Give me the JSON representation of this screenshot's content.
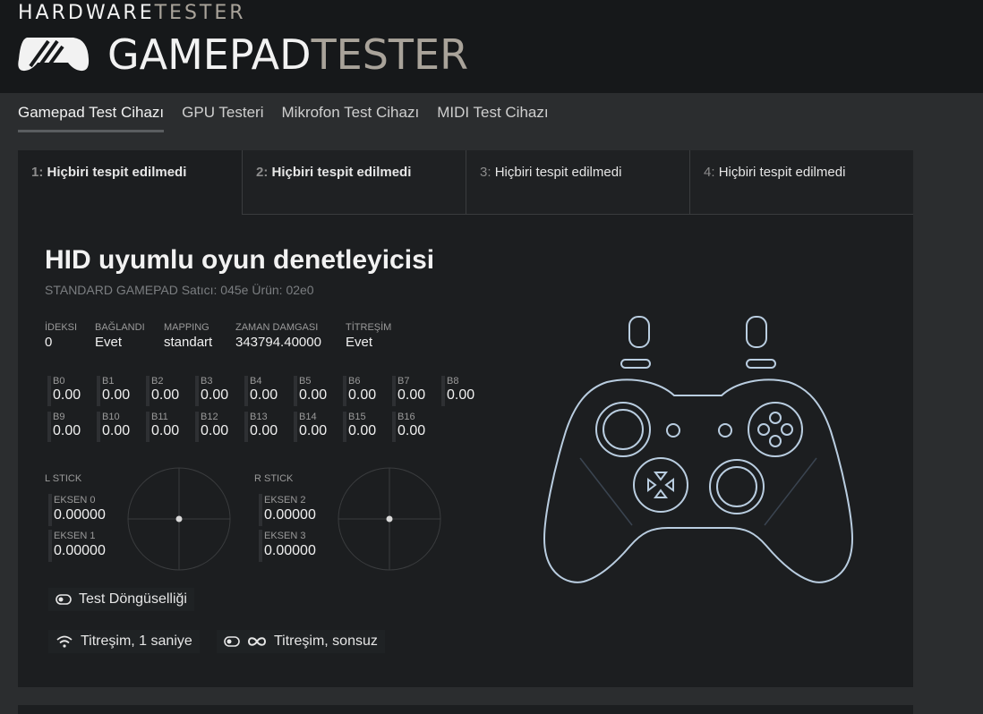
{
  "brand": {
    "small_1": "HARDWARE",
    "small_2": "TESTER",
    "big_1": "GAMEPAD",
    "big_2": "TESTER"
  },
  "nav": [
    "Gamepad Test Cihazı",
    "GPU Testeri",
    "Mikrofon Test Cihazı",
    "MIDI Test Cihazı"
  ],
  "tabs": [
    {
      "num": "1:",
      "label": "Hiçbiri tespit edilmedi"
    },
    {
      "num": "2:",
      "label": "Hiçbiri tespit edilmedi"
    },
    {
      "num": "3:",
      "label": "Hiçbiri tespit edilmedi"
    },
    {
      "num": "4:",
      "label": "Hiçbiri tespit edilmedi"
    }
  ],
  "device": {
    "title": "HID uyumlu oyun denetleyicisi",
    "subtitle": "STANDARD GAMEPAD Satıcı: 045e Ürün: 02e0"
  },
  "info": [
    {
      "label": "İDEKSI",
      "value": "0"
    },
    {
      "label": "BAĞLANDI",
      "value": "Evet"
    },
    {
      "label": "MAPPING",
      "value": "standart"
    },
    {
      "label": "ZAMAN DAMGASI",
      "value": "343794.40000"
    },
    {
      "label": "TİTREŞİM",
      "value": "Evet"
    }
  ],
  "buttons": [
    {
      "label": "B0",
      "value": "0.00"
    },
    {
      "label": "B1",
      "value": "0.00"
    },
    {
      "label": "B2",
      "value": "0.00"
    },
    {
      "label": "B3",
      "value": "0.00"
    },
    {
      "label": "B4",
      "value": "0.00"
    },
    {
      "label": "B5",
      "value": "0.00"
    },
    {
      "label": "B6",
      "value": "0.00"
    },
    {
      "label": "B7",
      "value": "0.00"
    },
    {
      "label": "B8",
      "value": "0.00"
    },
    {
      "label": "B9",
      "value": "0.00"
    },
    {
      "label": "B10",
      "value": "0.00"
    },
    {
      "label": "B11",
      "value": "0.00"
    },
    {
      "label": "B12",
      "value": "0.00"
    },
    {
      "label": "B13",
      "value": "0.00"
    },
    {
      "label": "B14",
      "value": "0.00"
    },
    {
      "label": "B15",
      "value": "0.00"
    },
    {
      "label": "B16",
      "value": "0.00"
    }
  ],
  "sticks": {
    "left": {
      "label": "L STICK",
      "axes": [
        {
          "label": "EKSEN 0",
          "value": "0.00000"
        },
        {
          "label": "EKSEN 1",
          "value": "0.00000"
        }
      ]
    },
    "right": {
      "label": "R STICK",
      "axes": [
        {
          "label": "EKSEN 2",
          "value": "0.00000"
        },
        {
          "label": "EKSEN 3",
          "value": "0.00000"
        }
      ]
    }
  },
  "controls": {
    "loop": "Test Döngüselliği",
    "vibrate_1s": "Titreşim, 1 saniye",
    "vibrate_inf": "Titreşim, sonsuz"
  },
  "colors": {
    "accent": "#a9a39a",
    "gamepad_outline": "#b9cde0"
  }
}
